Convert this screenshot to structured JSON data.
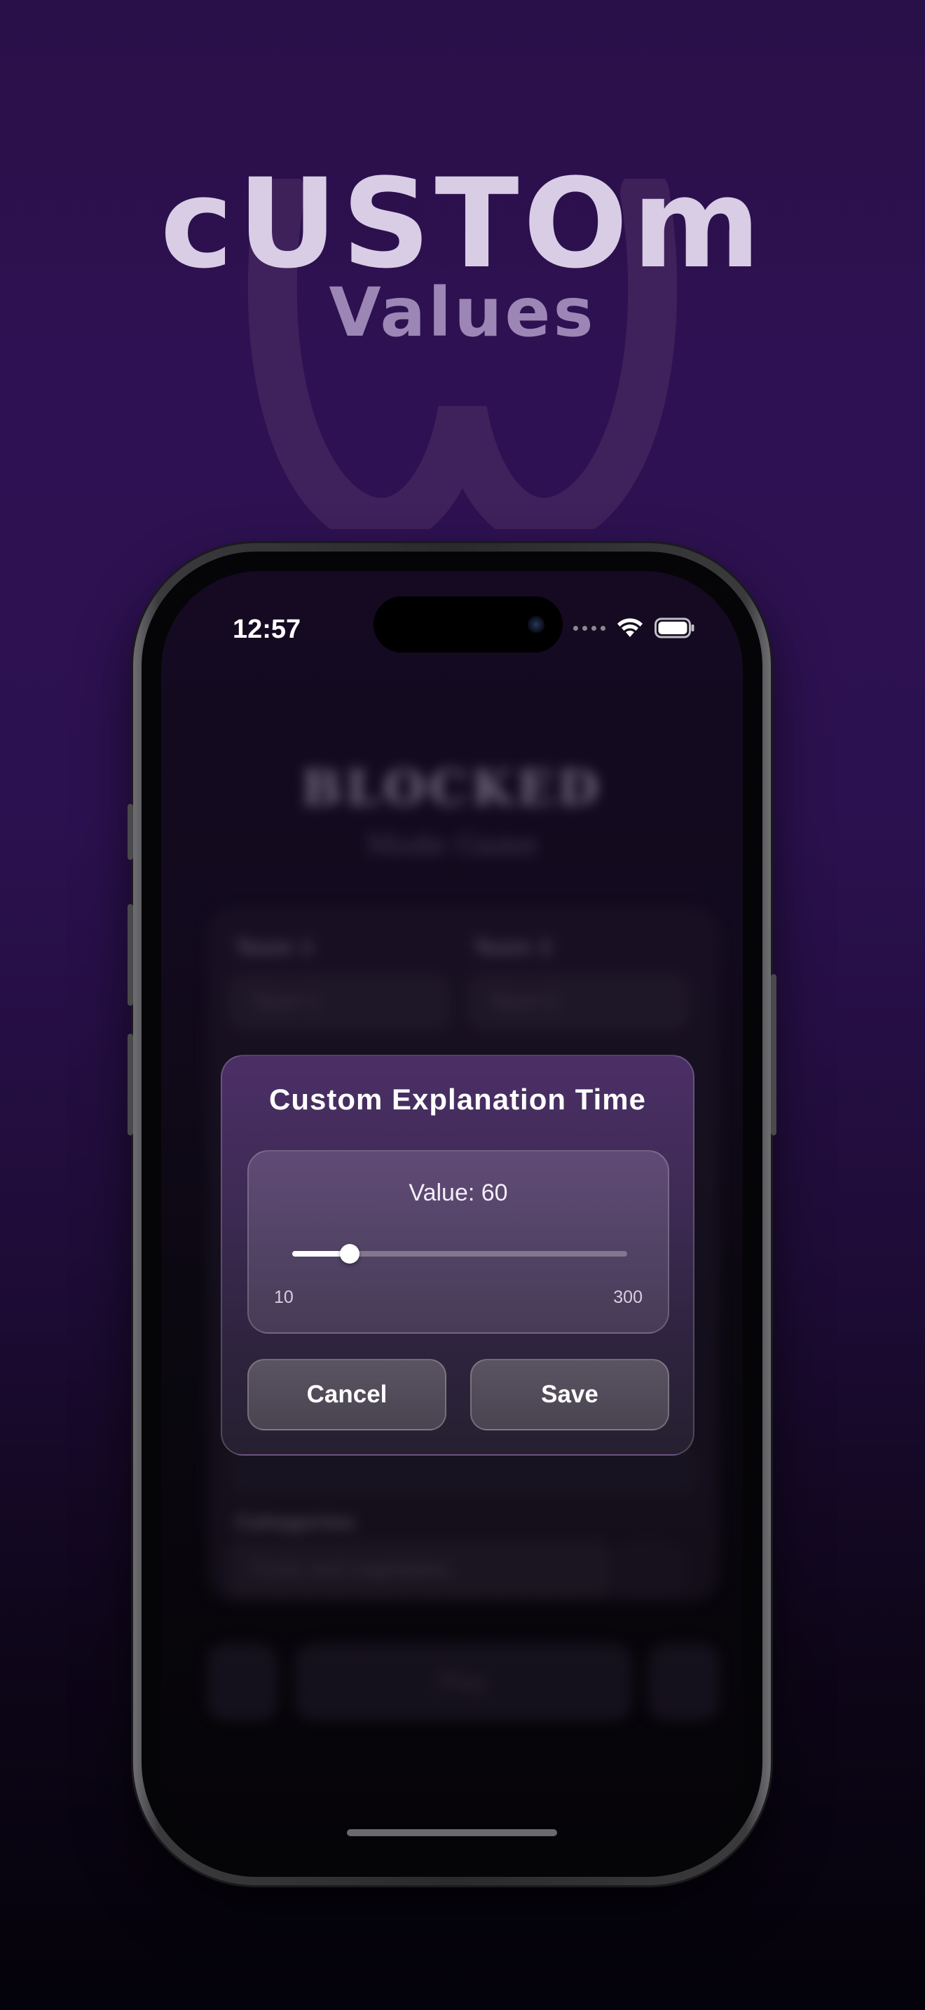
{
  "hero": {
    "title": "cUSTOm",
    "subtitle": "Values"
  },
  "status_bar": {
    "time": "12:57",
    "icons": [
      "signal-dots-icon",
      "wifi-icon",
      "battery-icon"
    ]
  },
  "background_app": {
    "title": "BLOCKED",
    "subtitle": "Mode Game",
    "team1_label": "Team 1",
    "team2_label": "Team 2",
    "team1_value": "Team 1",
    "team2_value": "Team 2",
    "categories_label": "Categories",
    "category_value": "Fruits and vegetables",
    "play_label": "Play"
  },
  "dialog": {
    "title": "Custom Explanation Time",
    "value_text": "Value: 60",
    "slider": {
      "min": 10,
      "max": 300,
      "value": 60
    },
    "min_label": "10",
    "max_label": "300",
    "cancel_label": "Cancel",
    "save_label": "Save"
  },
  "colors": {
    "background_top": "#2e1152",
    "background_bottom": "#04020a",
    "dialog_top": "#4b2f66",
    "accent": "#ffffff"
  }
}
